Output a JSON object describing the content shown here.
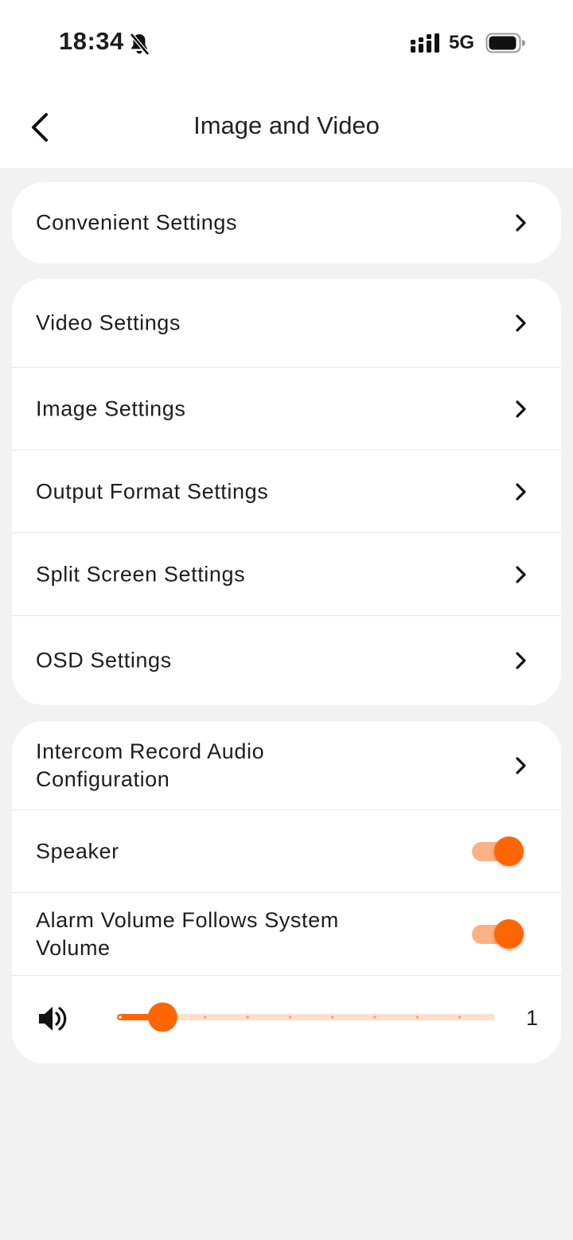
{
  "status": {
    "time": "18:34",
    "network": "5G"
  },
  "nav": {
    "title": "Image and Video"
  },
  "groups": [
    {
      "items": [
        {
          "label": "Convenient Settings",
          "type": "link"
        }
      ]
    },
    {
      "items": [
        {
          "label": "Video Settings",
          "type": "link"
        },
        {
          "label": "Image Settings",
          "type": "link"
        },
        {
          "label": "Output Format Settings",
          "type": "link"
        },
        {
          "label": "Split Screen Settings",
          "type": "link"
        },
        {
          "label": "OSD Settings",
          "type": "link"
        }
      ]
    },
    {
      "items": [
        {
          "label": "Intercom Record Audio Configuration",
          "type": "link"
        },
        {
          "label": "Speaker",
          "type": "toggle",
          "on": true
        },
        {
          "label": "Alarm Volume Follows System Volume",
          "type": "toggle",
          "on": true
        }
      ]
    }
  ],
  "volume": {
    "value": "1",
    "min": 0,
    "max": 9,
    "level": 1
  },
  "colors": {
    "accent": "#fe6604",
    "accent_light": "#fbb183",
    "slider_track": "#fde0cc"
  }
}
